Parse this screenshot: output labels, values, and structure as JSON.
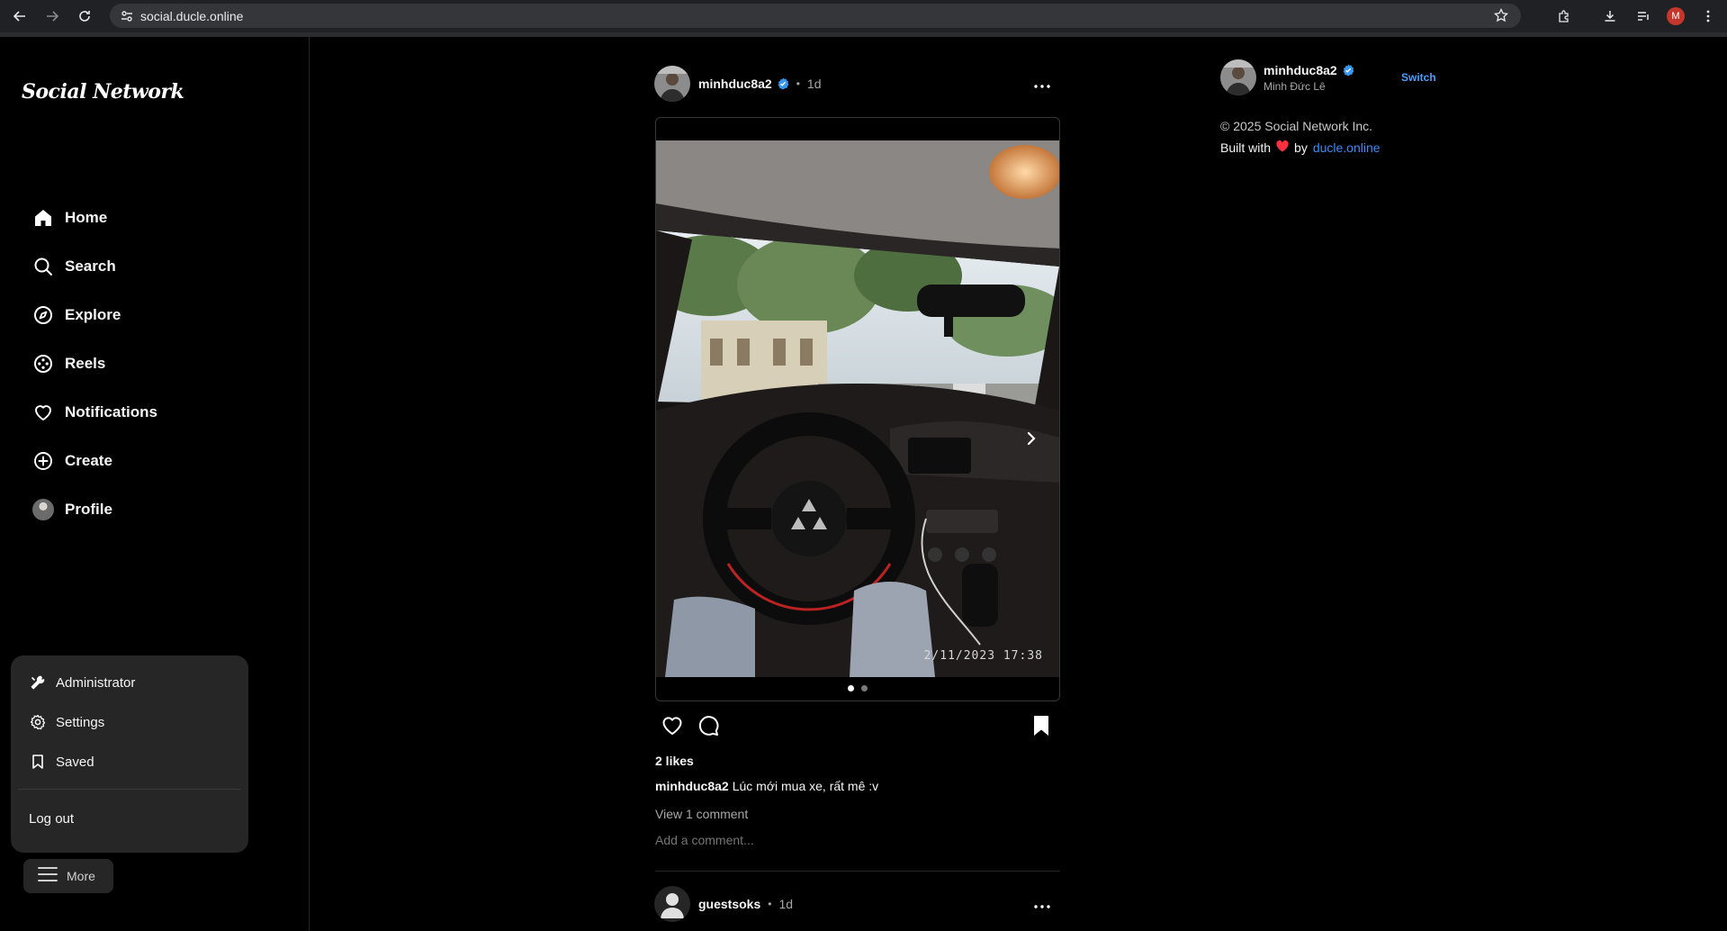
{
  "browser": {
    "url": "social.ducle.online",
    "profile_initial": "M"
  },
  "sidebar": {
    "logo": "Social Network",
    "items": [
      {
        "label": "Home",
        "icon": "home-icon"
      },
      {
        "label": "Search",
        "icon": "search-icon"
      },
      {
        "label": "Explore",
        "icon": "compass-icon"
      },
      {
        "label": "Reels",
        "icon": "reels-icon"
      },
      {
        "label": "Notifications",
        "icon": "heart-icon"
      },
      {
        "label": "Create",
        "icon": "plus-circle-icon"
      },
      {
        "label": "Profile",
        "icon": "avatar"
      }
    ],
    "more_menu": {
      "items": [
        {
          "label": "Administrator",
          "icon": "tools-icon"
        },
        {
          "label": "Settings",
          "icon": "gear-icon"
        },
        {
          "label": "Saved",
          "icon": "bookmark-icon"
        }
      ],
      "logout_label": "Log out"
    },
    "more_label": "More"
  },
  "feed": {
    "post": {
      "username": "minhduc8a2",
      "verified": true,
      "time": "1d",
      "photo_stamp": "2/11/2023 17:38",
      "slide_count": 2,
      "active_slide": 1,
      "likes": "2 likes",
      "caption_user": "minhduc8a2",
      "caption_text": "Lúc mới mua xe, rất mê :v",
      "view_comments": "View 1 comment",
      "add_comment_placeholder": "Add a comment..."
    },
    "next_post": {
      "username": "guestsoks",
      "time": "1d"
    }
  },
  "right_panel": {
    "username": "minhduc8a2",
    "display_name": "Minh Đức Lê",
    "switch_label": "Switch",
    "copyright": "© 2025 Social Network Inc.",
    "built_with": "Built with",
    "by": "by",
    "link": "ducle.online"
  },
  "colors": {
    "accent": "#4a9eff",
    "verified": "#3897f0",
    "heart": "#ff3040"
  }
}
